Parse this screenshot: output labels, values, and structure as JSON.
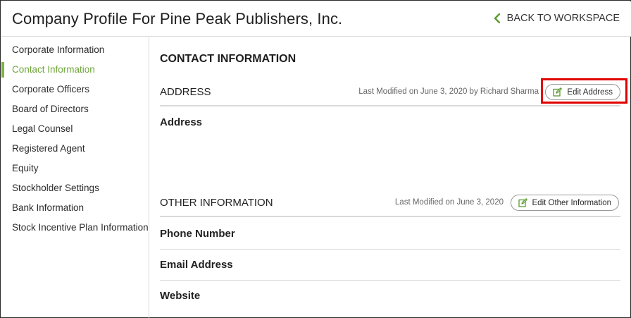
{
  "header": {
    "title": "Company Profile For Pine Peak Publishers, Inc.",
    "back_label": "BACK TO WORKSPACE",
    "back_icon": "chevron-left-icon",
    "accent_color": "#6ea53a"
  },
  "sidebar": {
    "items": [
      {
        "label": "Corporate Information"
      },
      {
        "label": "Contact Information",
        "active": true
      },
      {
        "label": "Corporate Officers"
      },
      {
        "label": "Board of Directors"
      },
      {
        "label": "Legal Counsel"
      },
      {
        "label": "Registered Agent"
      },
      {
        "label": "Equity"
      },
      {
        "label": "Stockholder Settings"
      },
      {
        "label": "Bank Information"
      },
      {
        "label": "Stock Incentive Plan Information"
      }
    ]
  },
  "main": {
    "section_title": "CONTACT INFORMATION",
    "address": {
      "title": "ADDRESS",
      "modified": "Last Modified on June 3, 2020 by Richard Sharma",
      "edit_label": "Edit Address",
      "edit_icon": "edit-icon",
      "field_label": "Address",
      "highlight_color": "#e00000"
    },
    "other": {
      "title": "OTHER INFORMATION",
      "modified": "Last Modified on June 3, 2020",
      "edit_label": "Edit Other Information",
      "edit_icon": "edit-icon",
      "fields": [
        "Phone Number",
        "Email Address",
        "Website"
      ]
    }
  }
}
